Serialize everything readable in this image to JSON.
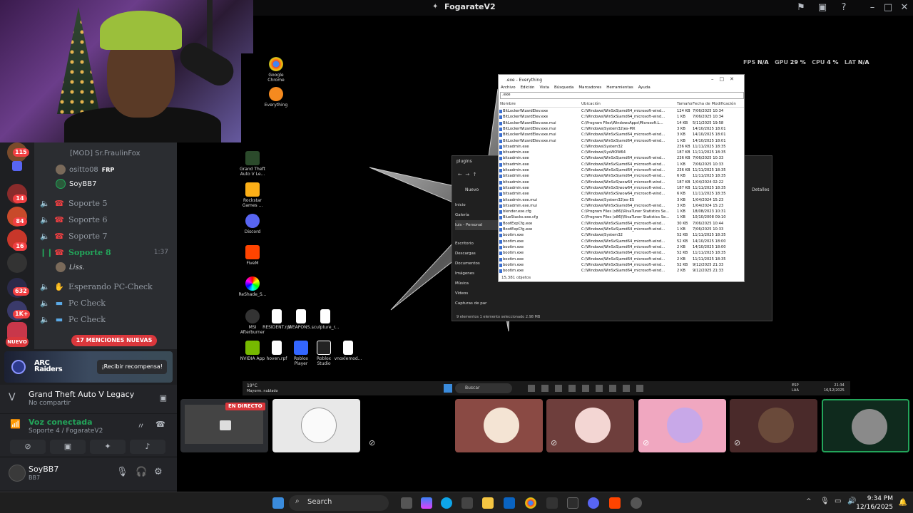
{
  "top_bar": {
    "title": "FogarateV2"
  },
  "perf": {
    "fps_label": "FPS",
    "fps": "N/A",
    "gpu_label": "GPU",
    "gpu": "29 %",
    "cpu_label": "CPU",
    "cpu": "4 %",
    "lat_label": "LAT",
    "lat": "N/A"
  },
  "guild_badges": [
    "115",
    "14",
    "84",
    "16",
    "632",
    "1K+"
  ],
  "channels": {
    "mod_user": "[MOD] Sr.FraulinFox",
    "user1": "ositto08",
    "user1_tag": "FRP",
    "user2": "SoyBB7",
    "items": [
      {
        "label": "Soporte 5"
      },
      {
        "label": "Soporte 6"
      },
      {
        "label": "Soporte 7"
      },
      {
        "label": "Soporte 8",
        "time": "1:37"
      },
      {
        "label": "Esperando PC-Check"
      },
      {
        "label": "Pc Check"
      },
      {
        "label": "Pc Check"
      }
    ],
    "user3": "Liss."
  },
  "mentions": "17 MENCIONES NUEVAS",
  "nuevo": "NUEVO",
  "promo": {
    "brand": "ARC Raiders",
    "button": "¡Recibir recompensa!"
  },
  "activity": {
    "title": "Grand Theft Auto V Legacy",
    "subtitle": "No compartir"
  },
  "voice": {
    "title": "Voz conectada",
    "subtitle": "Soporte 4 / FogarateV2"
  },
  "user": {
    "name": "SoyBB7",
    "status": "BB7"
  },
  "desktop_icons": [
    "Google Chrome",
    "Everything",
    "Grand Theft Auto V Le...",
    "Rockstar Games ...",
    "Discord",
    "FiveM",
    "ReShade_S...",
    "MSI Afterburner",
    "RESIDENT.rpf",
    "WEAPONS...",
    "sculpture_r...",
    "NVIDIA App",
    "hoven.rpf",
    "Roblox Player",
    "Roblox Studio",
    "vnoxlemod..."
  ],
  "everything": {
    "title": ".exe - Everything",
    "menu": [
      "Archivo",
      "Edición",
      "Vista",
      "Búsqueda",
      "Marcadores",
      "Herramientas",
      "Ayuda"
    ],
    "search": ".exe",
    "columns": [
      "Nombre",
      "Ubicación",
      "Tamaño",
      "Fecha de Modificación"
    ],
    "rows": [
      [
        "BitLockerWizardElev.exe",
        "C:\\Windows\\WinSxS\\amd64_microsoft-wind...",
        "124 KB",
        "7/06/2025 10:34"
      ],
      [
        "BitLockerWizardElev.exe",
        "C:\\Windows\\WinSxS\\amd64_microsoft-wind...",
        "1 KB",
        "7/06/2025 10:34"
      ],
      [
        "BitLockerWizardElev.exe.mui",
        "C:\\Program Files\\WindowsApps\\Microsoft.L...",
        "14 KB",
        "5/11/2025 19:58"
      ],
      [
        "BitLockerWizardElev.exe.mui",
        "C:\\Windows\\System32\\es-MX",
        "3 KB",
        "14/10/2025 18:01"
      ],
      [
        "BitLockerWizardElev.exe.mui",
        "C:\\Windows\\WinSxS\\amd64_microsoft-wind...",
        "3 KB",
        "14/10/2025 18:01"
      ],
      [
        "BitLockerWizardElev.exe.mui",
        "C:\\Windows\\WinSxS\\amd64_microsoft-wind...",
        "1 KB",
        "14/10/2025 18:01"
      ],
      [
        "bitsadmin.exe",
        "C:\\Windows\\System32",
        "236 KB",
        "11/11/2025 18:35"
      ],
      [
        "bitsadmin.exe",
        "C:\\Windows\\SysWOW64",
        "187 KB",
        "11/11/2025 18:35"
      ],
      [
        "bitsadmin.exe",
        "C:\\Windows\\WinSxS\\amd64_microsoft-wind...",
        "236 KB",
        "7/06/2025 10:33"
      ],
      [
        "bitsadmin.exe",
        "C:\\Windows\\WinSxS\\amd64_microsoft-wind...",
        "1 KB",
        "7/06/2025 10:33"
      ],
      [
        "bitsadmin.exe",
        "C:\\Windows\\WinSxS\\amd64_microsoft-wind...",
        "236 KB",
        "11/11/2025 18:35"
      ],
      [
        "bitsadmin.exe",
        "C:\\Windows\\WinSxS\\amd64_microsoft-wind...",
        "6 KB",
        "11/11/2025 18:35"
      ],
      [
        "bitsadmin.exe",
        "C:\\Windows\\WinSxS\\wow64_microsoft-wind...",
        "187 KB",
        "1/04/2024 02:22"
      ],
      [
        "bitsadmin.exe",
        "C:\\Windows\\WinSxS\\wow64_microsoft-wind...",
        "187 KB",
        "11/11/2025 18:35"
      ],
      [
        "bitsadmin.exe",
        "C:\\Windows\\WinSxS\\wow64_microsoft-wind...",
        "6 KB",
        "11/11/2025 18:35"
      ],
      [
        "bitsadmin.exe.mui",
        "C:\\Windows\\System32\\es-ES",
        "3 KB",
        "1/04/2024 15:23"
      ],
      [
        "bitsadmin.exe.mui",
        "C:\\Windows\\WinSxS\\amd64_microsoft-wind...",
        "3 KB",
        "1/04/2024 15:23"
      ],
      [
        "blender.exe.cfg",
        "C:\\Program Files (x86)\\RivaTuner Statistics Se...",
        "1 KB",
        "18/08/2023 10:31"
      ],
      [
        "BlueStacks.exe.cfg",
        "C:\\Program Files (x86)\\RivaTuner Statistics Se...",
        "1 KB",
        "10/10/2008 09:10"
      ],
      [
        "BootExpCfg.exe",
        "C:\\Windows\\WinSxS\\amd64_microsoft-wind...",
        "30 KB",
        "7/06/2025 10:44"
      ],
      [
        "BootExpCfg.exe",
        "C:\\Windows\\WinSxS\\amd64_microsoft-wind...",
        "1 KB",
        "7/06/2025 10:33"
      ],
      [
        "bootim.exe",
        "C:\\Windows\\System32",
        "52 KB",
        "11/11/2025 18:35"
      ],
      [
        "bootim.exe",
        "C:\\Windows\\WinSxS\\amd64_microsoft-wind...",
        "52 KB",
        "14/10/2025 18:00"
      ],
      [
        "bootim.exe",
        "C:\\Windows\\WinSxS\\amd64_microsoft-wind...",
        "2 KB",
        "14/10/2025 18:00"
      ],
      [
        "bootim.exe",
        "C:\\Windows\\WinSxS\\amd64_microsoft-wind...",
        "52 KB",
        "11/11/2025 18:35"
      ],
      [
        "bootim.exe",
        "C:\\Windows\\WinSxS\\amd64_microsoft-wind...",
        "2 KB",
        "11/11/2025 18:35"
      ],
      [
        "bootim.exe",
        "C:\\Windows\\WinSxS\\amd64_microsoft-wind...",
        "52 KB",
        "9/12/2025 21:33"
      ],
      [
        "bootim.exe",
        "C:\\Windows\\WinSxS\\amd64_microsoft-wind...",
        "2 KB",
        "9/12/2025 21:33"
      ]
    ],
    "status": "15,381 objetos"
  },
  "explorer": {
    "title": "plugins",
    "new_btn": "Nuevo",
    "details": "Detalles",
    "nav": [
      "Inicio",
      "Galería",
      "luis - Personal",
      "Escritorio",
      "Descargas",
      "Documentos",
      "Imágenes",
      "Música",
      "Videos",
      "Capturas de par"
    ],
    "status": "9 elementos   1 elemento seleccionado 2.98 MB"
  },
  "remote_taskbar": {
    "weather": "19°C",
    "weather_sub": "Mayorm. nublado",
    "search": "Buscar",
    "lang": "ESP",
    "lang2": "LAA",
    "time": "21:34",
    "date": "16/12/2025"
  },
  "stream": {
    "live_label": "EN DIRECTO"
  },
  "taskbar": {
    "search": "Search",
    "time": "9:34 PM",
    "date": "12/16/2025"
  }
}
